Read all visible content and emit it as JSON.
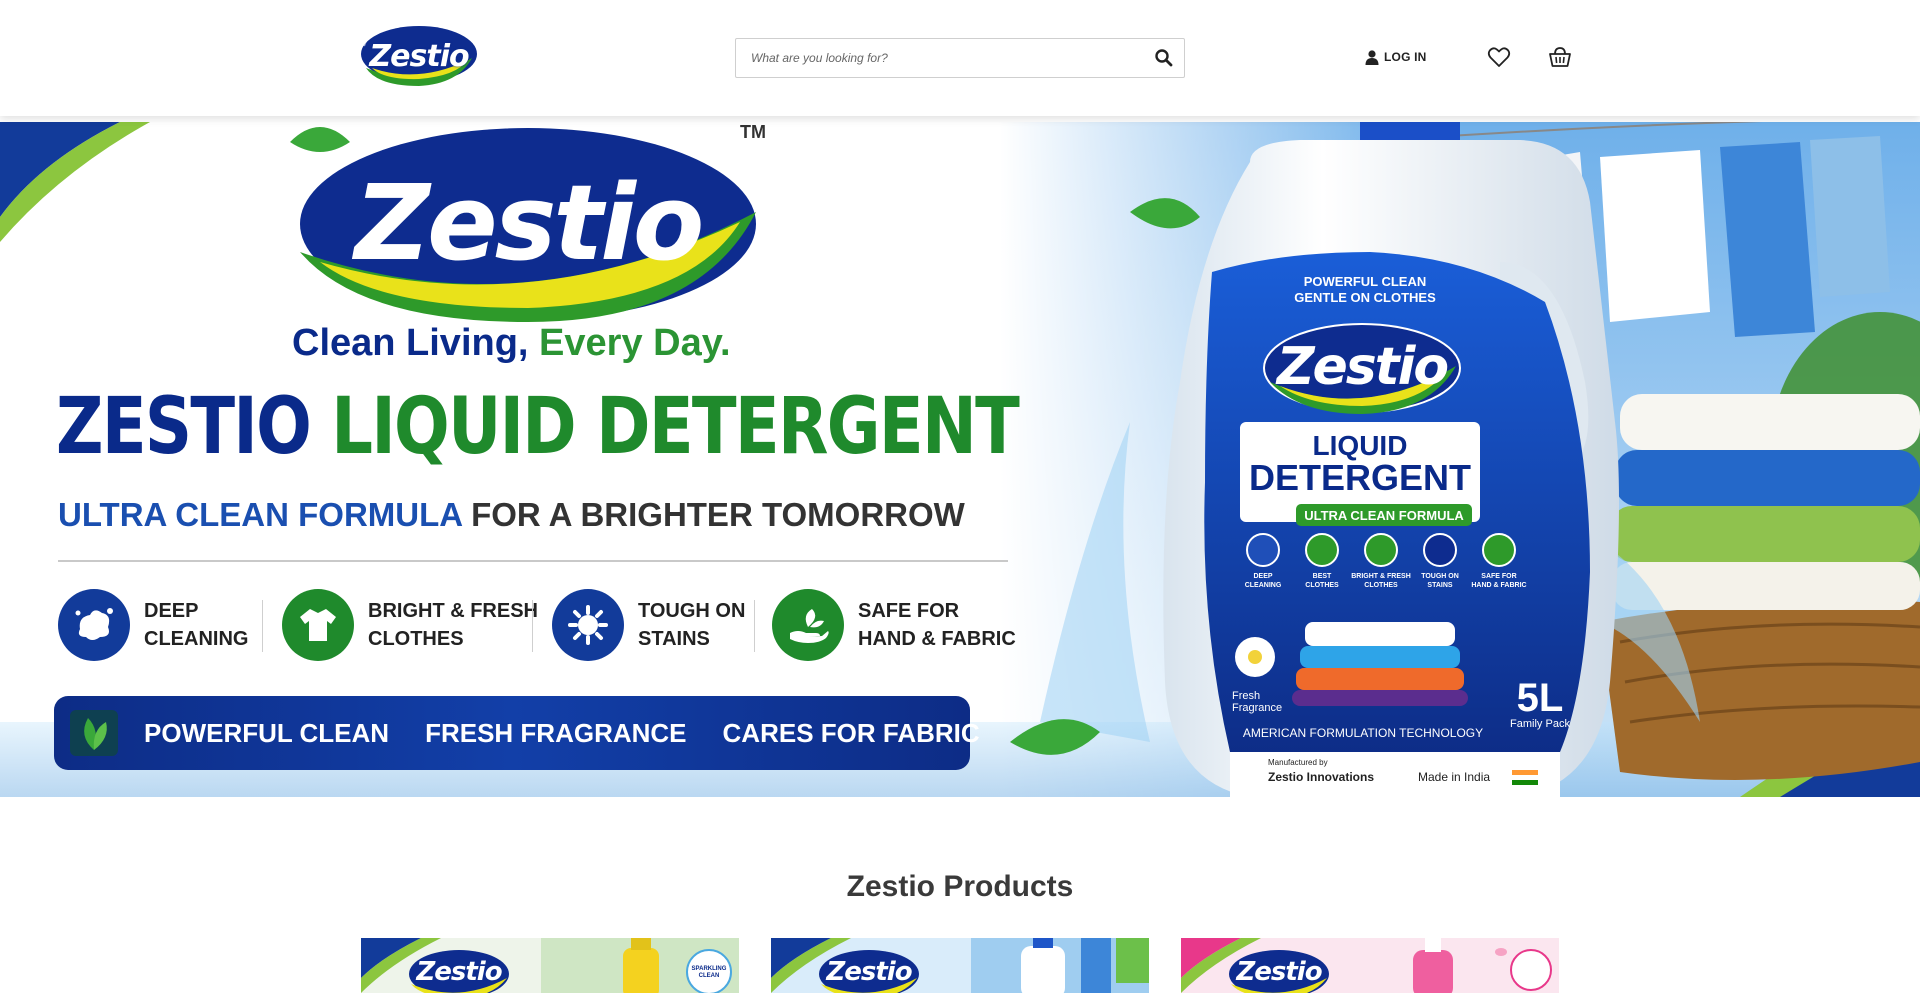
{
  "header": {
    "logo_text": "Zestio",
    "search": {
      "placeholder": "What are you looking for?",
      "value": ""
    },
    "login_label": "LOG IN",
    "icons": [
      "search-icon",
      "user-icon",
      "heart-icon",
      "cart-icon"
    ]
  },
  "hero": {
    "brand": "Zestio",
    "trademark": "TM",
    "tagline_part1": "Clean Living,",
    "tagline_part2": "Every Day.",
    "headline_part1": "ZESTIO",
    "headline_part2": "LIQUID DETERGENT",
    "subline_part1": "ULTRA CLEAN FORMULA",
    "subline_part2": "FOR A BRIGHTER TOMORROW",
    "features": [
      {
        "line1": "DEEP",
        "line2": "CLEANING",
        "icon": "splash-icon"
      },
      {
        "line1": "BRIGHT & FRESH",
        "line2": "CLOTHES",
        "icon": "shirt-icon"
      },
      {
        "line1": "TOUGH ON",
        "line2": "STAINS",
        "icon": "stain-burst-icon"
      },
      {
        "line1": "SAFE FOR",
        "line2": "HAND & FABRIC",
        "icon": "hand-leaf-icon"
      }
    ],
    "band": [
      "POWERFUL CLEAN",
      "FRESH FRAGRANCE",
      "CARES FOR FABRIC"
    ],
    "bottle": {
      "top_line1": "POWERFUL CLEAN",
      "top_line2": "GENTLE ON CLOTHES",
      "brand": "Zestio",
      "name_line1": "LIQUID",
      "name_line2": "DETERGENT",
      "badge": "ULTRA CLEAN FORMULA",
      "features": [
        {
          "line1": "DEEP",
          "line2": "CLEANING"
        },
        {
          "line1": "BEST",
          "line2": "CLOTHES"
        },
        {
          "line1": "BRIGHT & FRESH",
          "line2": "CLOTHES"
        },
        {
          "line1": "TOUGH ON",
          "line2": "STAINS"
        },
        {
          "line1": "SAFE FOR",
          "line2": "HAND & FABRIC"
        }
      ],
      "fragrance_line1": "Fresh",
      "fragrance_line2": "Fragrance",
      "size": "5L",
      "size_caption": "Family Pack",
      "tech": "AMERICAN FORMULATION TECHNOLOGY",
      "mfg_label": "Manufactured by",
      "mfg_name": "Zestio Innovations",
      "made_in": "Made in India"
    }
  },
  "products": {
    "title": "Zestio Products",
    "cards": [
      {
        "brand": "Zestio",
        "badge_line1": "SPARKLING",
        "badge_line2": "CLEAN",
        "accent": "#f4d21f"
      },
      {
        "brand": "Zestio",
        "accent": "#1e56c8"
      },
      {
        "brand": "Zestio",
        "accent": "#e8388a"
      }
    ]
  },
  "colors": {
    "brand_blue": "#0a2a8a",
    "brand_green": "#1f8a2c",
    "band_blue": "#123fa8",
    "header_bg": "#ffffff"
  }
}
